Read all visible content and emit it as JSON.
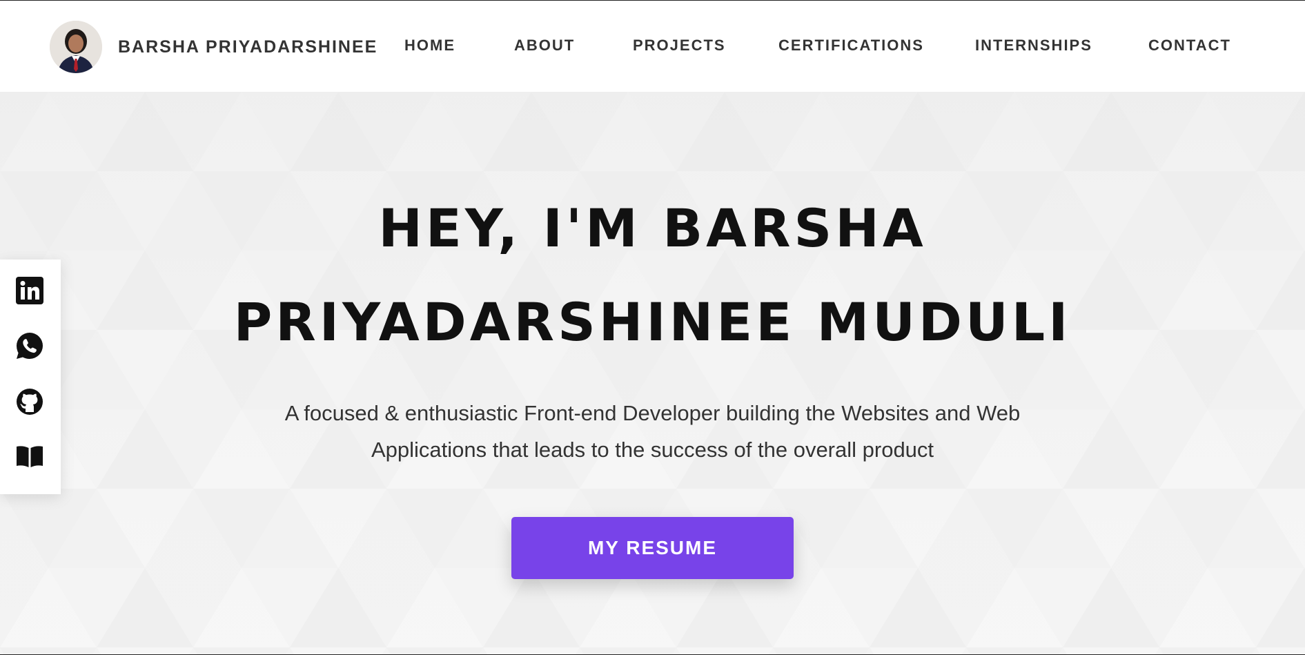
{
  "header": {
    "brand_name": "BARSHA PRIYADARSHINEE",
    "avatar_alt": "avatar",
    "nav": [
      {
        "label": "HOME"
      },
      {
        "label": "ABOUT"
      },
      {
        "label": "PROJECTS"
      },
      {
        "label": "CERTIFICATIONS"
      },
      {
        "label": "INTERNSHIPS"
      },
      {
        "label": "CONTACT"
      }
    ]
  },
  "hero": {
    "title_line1": "HEY, I'M BARSHA",
    "title_line2": "PRIYADARSHINEE MUDULI",
    "subtitle_line1": "A focused & enthusiastic Front-end Developer building the Websites and Web",
    "subtitle_line2": "Applications that leads to the success of the overall product",
    "resume_button": "MY RESUME"
  },
  "social": [
    {
      "icon": "linkedin-icon"
    },
    {
      "icon": "whatsapp-icon"
    },
    {
      "icon": "github-icon"
    },
    {
      "icon": "book-icon"
    }
  ],
  "colors": {
    "accent": "#7843e9",
    "header_bg": "#ffffff",
    "hero_bg": "#f3f3f3",
    "text_dark": "#111111",
    "text_body": "#333333"
  }
}
